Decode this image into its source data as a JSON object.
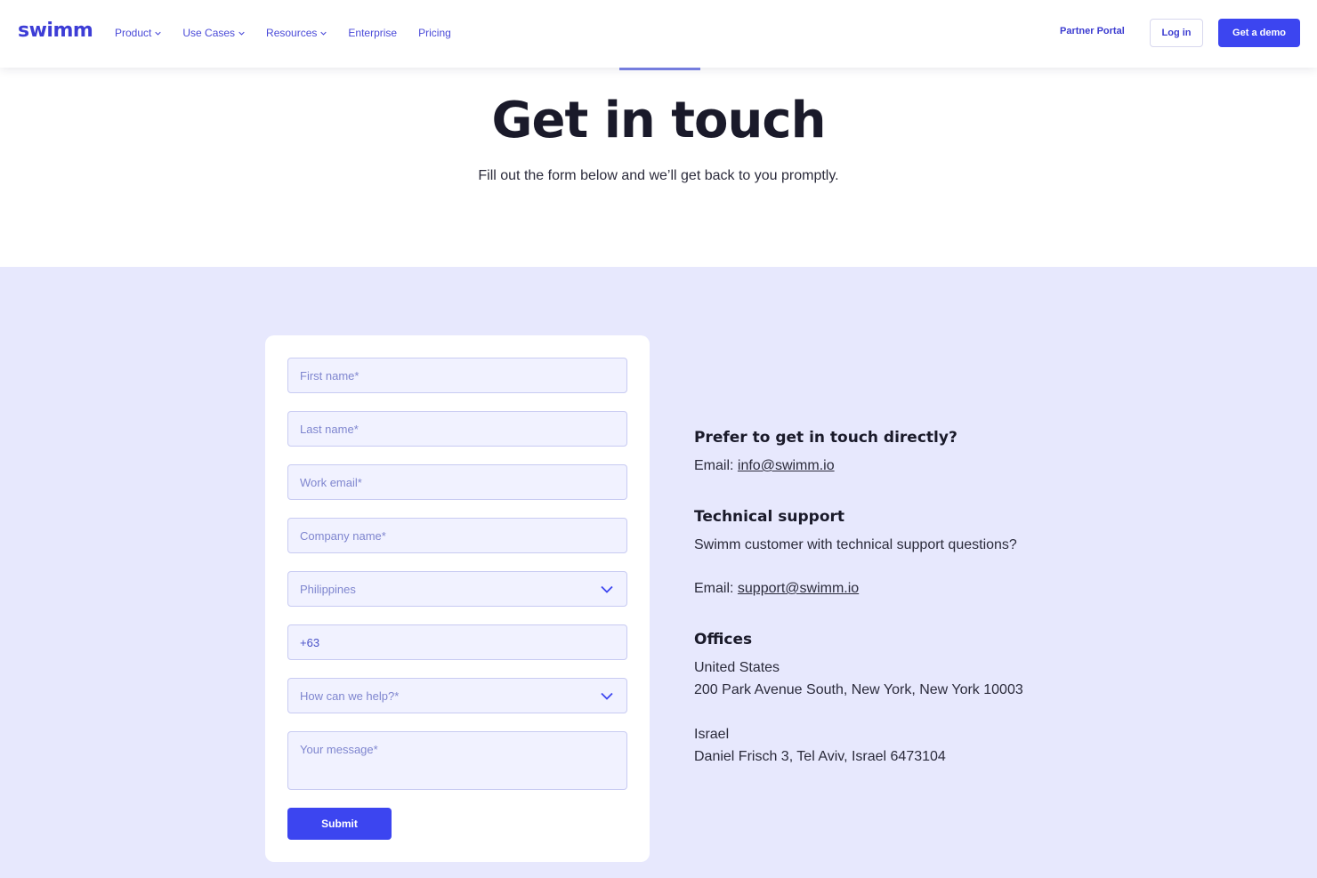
{
  "header": {
    "logo": "swimm",
    "nav": [
      {
        "label": "Product",
        "has_dropdown": true
      },
      {
        "label": "Use Cases",
        "has_dropdown": true
      },
      {
        "label": "Resources",
        "has_dropdown": true
      },
      {
        "label": "Enterprise",
        "has_dropdown": false
      },
      {
        "label": "Pricing",
        "has_dropdown": false
      }
    ],
    "partner_portal": "Partner Portal",
    "login": "Log in",
    "demo": "Get a demo"
  },
  "hero": {
    "title": "Get in touch",
    "subtitle": "Fill out the form below and we’ll get back to you promptly."
  },
  "form": {
    "first_name_placeholder": "First name*",
    "last_name_placeholder": "Last name*",
    "work_email_placeholder": "Work email*",
    "company_placeholder": "Company name*",
    "country_selected": "Philippines",
    "phone_value": "+63",
    "help_placeholder": "How can we help?*",
    "message_placeholder": "Your message*",
    "submit": "Submit"
  },
  "info": {
    "direct_heading": "Prefer to get in touch directly?",
    "email_label": "Email: ",
    "info_email": "info@swimm.io",
    "support_heading": "Technical support",
    "support_text": "Swimm customer with technical support questions?",
    "support_email": "support@swimm.io",
    "offices_heading": "Offices",
    "office_us_country": "United States",
    "office_us_address": "200 Park Avenue South, New York, New York 10003",
    "office_il_country": "Israel",
    "office_il_address": "Daniel Frisch 3, Tel Aviv, Israel 6473104"
  },
  "colors": {
    "brand": "#3c45f0",
    "section_bg": "#e7e8fd",
    "field_bg": "#f1f2ff"
  }
}
